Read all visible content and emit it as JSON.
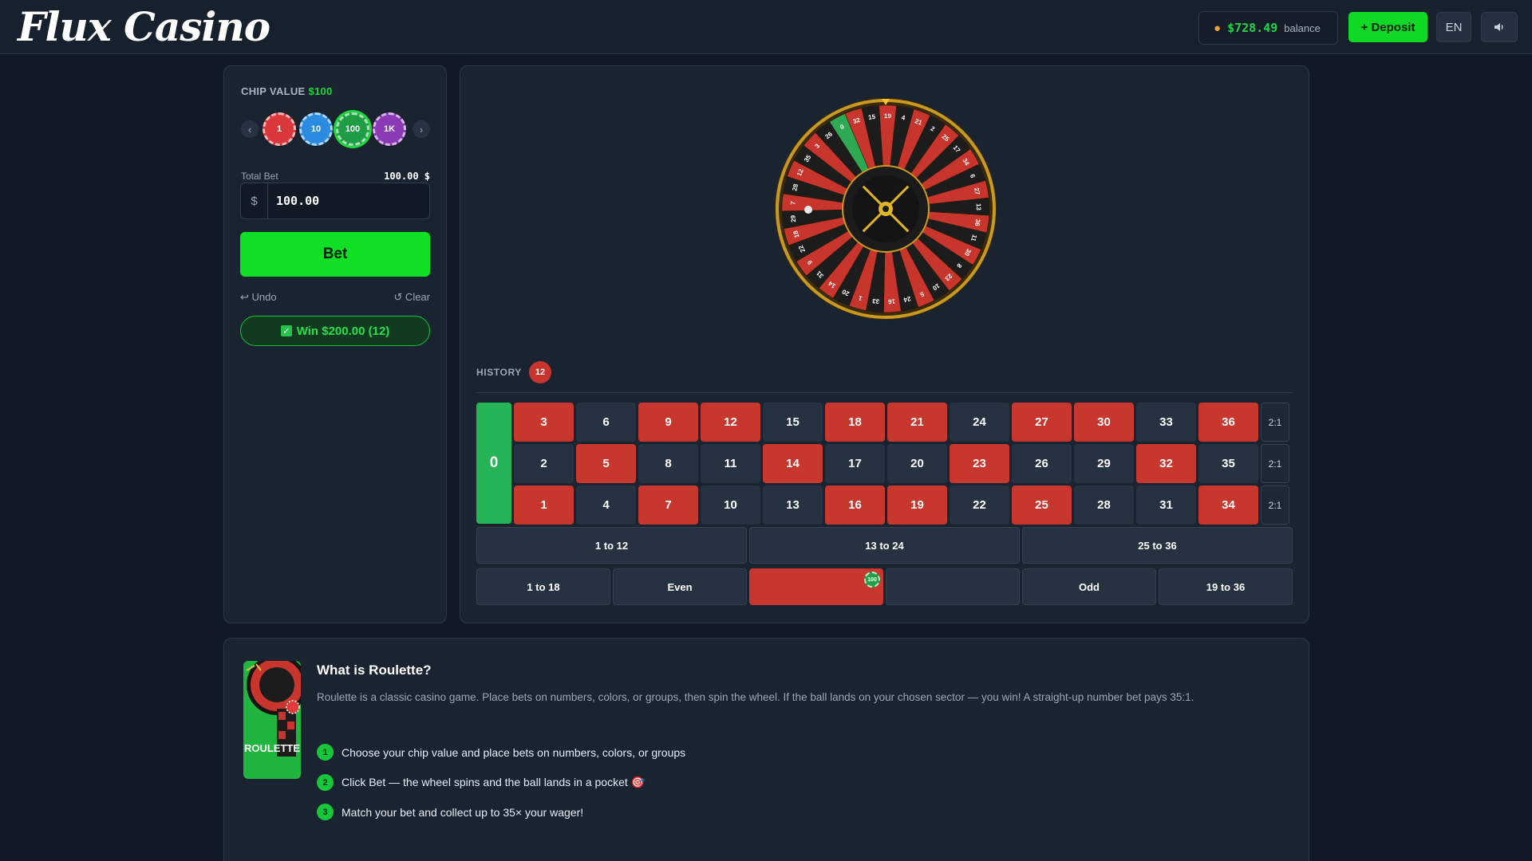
{
  "header": {
    "logo": "Flux Casino",
    "balance_amount": "$728.49",
    "balance_label": "balance",
    "deposit_label": "+ Deposit",
    "lang": "EN"
  },
  "bet_panel": {
    "chip_value_label": "CHIP VALUE",
    "chip_value": "$100",
    "chips": [
      {
        "label": "1",
        "color": "#d9373a"
      },
      {
        "label": "10",
        "color": "#2b8be0"
      },
      {
        "label": "100",
        "color": "#1f9d45"
      },
      {
        "label": "1K",
        "color": "#8a3ab5"
      }
    ],
    "selected_chip": "100",
    "prev_arrow": "‹",
    "next_arrow": "›",
    "total_bet_label": "Total Bet",
    "total_bet_value": "100.00 $",
    "currency_symbol": "$",
    "bet_input_value": "100.00",
    "bet_button": "Bet",
    "undo_label": "↩ Undo",
    "clear_label": "↺ Clear",
    "win_text": "Win $200.00 (12)"
  },
  "wheel": {
    "sequence": [
      0,
      32,
      15,
      19,
      4,
      21,
      2,
      25,
      17,
      34,
      6,
      27,
      13,
      36,
      11,
      30,
      8,
      23,
      10,
      5,
      24,
      16,
      33,
      1,
      20,
      14,
      31,
      9,
      22,
      18,
      29,
      7,
      28,
      12,
      35,
      3,
      26
    ],
    "red_numbers": [
      1,
      3,
      5,
      7,
      9,
      12,
      14,
      16,
      18,
      19,
      21,
      23,
      25,
      27,
      30,
      32,
      34,
      36
    ],
    "colors": {
      "red": "#c8352c",
      "black": "#1c1c1c",
      "green": "#2eaa55",
      "rim": "#c99a1e"
    }
  },
  "history": {
    "label": "HISTORY",
    "results": [
      {
        "number": "12",
        "color": "red"
      }
    ]
  },
  "table": {
    "zero": "0",
    "rows": [
      [
        {
          "n": "3",
          "c": "red"
        },
        {
          "n": "6",
          "c": "black"
        },
        {
          "n": "9",
          "c": "red"
        },
        {
          "n": "12",
          "c": "red"
        },
        {
          "n": "15",
          "c": "black"
        },
        {
          "n": "18",
          "c": "red"
        },
        {
          "n": "21",
          "c": "red"
        },
        {
          "n": "24",
          "c": "black"
        },
        {
          "n": "27",
          "c": "red"
        },
        {
          "n": "30",
          "c": "red"
        },
        {
          "n": "33",
          "c": "black"
        },
        {
          "n": "36",
          "c": "red"
        }
      ],
      [
        {
          "n": "2",
          "c": "black"
        },
        {
          "n": "5",
          "c": "red"
        },
        {
          "n": "8",
          "c": "black"
        },
        {
          "n": "11",
          "c": "black"
        },
        {
          "n": "14",
          "c": "red"
        },
        {
          "n": "17",
          "c": "black"
        },
        {
          "n": "20",
          "c": "black"
        },
        {
          "n": "23",
          "c": "red"
        },
        {
          "n": "26",
          "c": "black"
        },
        {
          "n": "29",
          "c": "black"
        },
        {
          "n": "32",
          "c": "red"
        },
        {
          "n": "35",
          "c": "black"
        }
      ],
      [
        {
          "n": "1",
          "c": "red"
        },
        {
          "n": "4",
          "c": "black"
        },
        {
          "n": "7",
          "c": "red"
        },
        {
          "n": "10",
          "c": "black"
        },
        {
          "n": "13",
          "c": "black"
        },
        {
          "n": "16",
          "c": "red"
        },
        {
          "n": "19",
          "c": "red"
        },
        {
          "n": "22",
          "c": "black"
        },
        {
          "n": "25",
          "c": "red"
        },
        {
          "n": "28",
          "c": "black"
        },
        {
          "n": "31",
          "c": "black"
        },
        {
          "n": "34",
          "c": "red"
        }
      ]
    ],
    "column_payout": "2:1",
    "dozens": [
      "1 to 12",
      "13 to 24",
      "25 to 36"
    ],
    "outside": [
      "1 to 18",
      "Even",
      "",
      "",
      "Odd",
      "19 to 36"
    ],
    "placed_chip": {
      "bet": "red",
      "label": "100"
    }
  },
  "info": {
    "thumb_text": "ROULETTE",
    "title": "What is Roulette?",
    "description": "Roulette is a classic casino game. Place bets on numbers, colors, or groups, then spin the wheel. If the ball lands on your chosen sector — you win! A straight-up number bet pays 35:1.",
    "steps": [
      {
        "num": "1",
        "text": "Choose your chip value and place bets on numbers, colors, or groups"
      },
      {
        "num": "2",
        "text": "Click Bet — the wheel spins and the ball lands in a pocket 🎯"
      },
      {
        "num": "3",
        "text": "Match your bet and collect up to 35× your wager!"
      }
    ]
  }
}
